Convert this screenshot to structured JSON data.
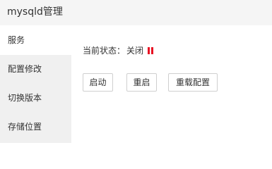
{
  "app": {
    "title": "mysqld管理"
  },
  "sidebar": {
    "items": [
      {
        "label": "服务",
        "active": true
      },
      {
        "label": "配置修改",
        "active": false
      },
      {
        "label": "切换版本",
        "active": false
      },
      {
        "label": "存储位置",
        "active": false
      }
    ]
  },
  "main": {
    "status_label": "当前状态：",
    "status_value": "关闭",
    "status_icon": "pause-icon",
    "status_color": "#e81123",
    "buttons": {
      "start": "启动",
      "restart": "重启",
      "reload_config": "重载配置"
    }
  }
}
